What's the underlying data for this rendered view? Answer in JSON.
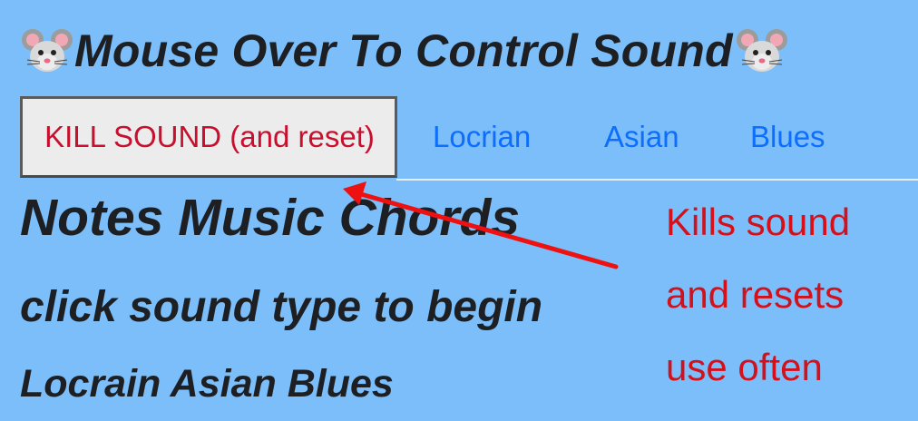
{
  "header": {
    "title": "Mouse Over To Control Sound",
    "left_icon": "mouse-face-icon",
    "right_icon": "mouse-face-icon"
  },
  "nav": {
    "kill_button_label": "KILL SOUND (and reset)",
    "links": [
      {
        "label": "Locrian"
      },
      {
        "label": "Asian"
      },
      {
        "label": "Blues"
      }
    ]
  },
  "main": {
    "heading": "Notes Music Chords",
    "subheading": "click sound type to begin",
    "types_line": "Locrain Asian Blues"
  },
  "annotation": {
    "lines": [
      "Kills sound",
      "and resets",
      "use often"
    ],
    "arrow_icon": "red-arrow-icon"
  },
  "colors": {
    "background": "#7bbef9",
    "text": "#1d1f23",
    "kill_button_text": "#c8102e",
    "link": "#0d6efd",
    "annotation": "#d4111b",
    "arrow": "#ee1111"
  }
}
